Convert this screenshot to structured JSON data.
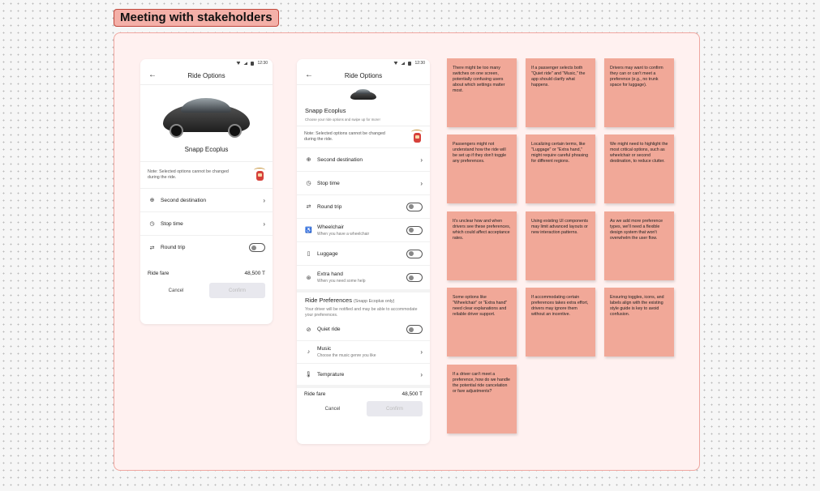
{
  "section_title": "Meeting with stakeholders",
  "phone_a": {
    "status_time": "12:30",
    "title": "Ride Options",
    "car_name": "Snapp Ecoplus",
    "note": "Note: Selected options cannot be changed during the ride.",
    "rows": [
      {
        "label": "Second destination",
        "icon": "plus-location-icon"
      },
      {
        "label": "Stop time",
        "icon": "timer-icon"
      },
      {
        "label": "Round trip",
        "icon": "round-trip-icon"
      }
    ],
    "fare_label": "Ride fare",
    "fare_value": "48,500 T",
    "cancel": "Cancel",
    "confirm": "Confirm"
  },
  "phone_b": {
    "status_time": "12:30",
    "title": "Ride Options",
    "car_name": "Snapp Ecoplus",
    "subtitle": "Choose your ride options and swipe up for more!",
    "note": "Note: Selected options cannot be changed during the ride.",
    "rows": [
      {
        "label": "Second destination",
        "sub": "",
        "icon": "plus-location-icon"
      },
      {
        "label": "Stop time",
        "sub": "",
        "icon": "timer-icon"
      },
      {
        "label": "Round trip",
        "sub": "",
        "icon": "round-trip-icon"
      },
      {
        "label": "Wheelchair",
        "sub": "When you have a wheelchair",
        "icon": "wheelchair-icon"
      },
      {
        "label": "Luggage",
        "sub": "",
        "icon": "luggage-icon"
      },
      {
        "label": "Extra hand",
        "sub": "When you need some help",
        "icon": "extra-hand-icon"
      }
    ],
    "prefs_title": "Ride Preferences",
    "prefs_note": "(Snapp Ecoplus only)",
    "prefs_sub": "Your driver will be notified and may be able to accommodate your preferences.",
    "pref_rows": [
      {
        "label": "Quiet ride",
        "sub": "",
        "icon": "quiet-icon"
      },
      {
        "label": "Music",
        "sub": "Choose the music genre you like",
        "icon": "music-icon"
      },
      {
        "label": "Temprature",
        "sub": "",
        "icon": "thermometer-icon"
      }
    ],
    "fare_label": "Ride fare",
    "fare_value": "48,500 T",
    "cancel": "Cancel",
    "confirm": "Confirm"
  },
  "stickies": [
    "There might be too many switches on one screen, potentially confusing users about which settings matter most.",
    "If a passenger selects both \"Quiet ride\" and \"Music,\" the app should clarify what happens.",
    "Drivers may want to confirm they can or can't meet a preference (e.g., no trunk space for luggage).",
    "Passengers might not understand how the ride will be set up if they don't toggle any preferences.",
    "Localizing certain terms, like \"Luggage\" or \"Extra hand,\" might require careful phrasing for different regions.",
    "We might need to highlight the most critical options, such as wheelchair or second destination, to reduce clutter.",
    "It's unclear how and when drivers see these preferences, which could affect acceptance rates.",
    "Using existing UI components may limit advanced layouts or new interaction patterns.",
    "As we add more preference types, we'll need a flexible design system that won't overwhelm the user flow.",
    "Some options like \"Wheelchair\" or \"Extra hand\" need clear explanations and reliable driver support.",
    "If accommodating certain preferences takes extra effort, drivers may ignore them without an incentive.",
    "Ensuring toggles, icons, and labels align with the existing style guide is key to avoid confusion.",
    "If a driver can't meet a preference, how do we handle the potential ride cancelation or fare adjustments?"
  ]
}
